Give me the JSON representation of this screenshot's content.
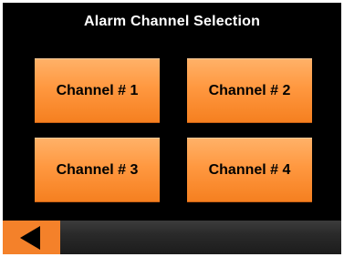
{
  "screen": {
    "title": "Alarm Channel Selection"
  },
  "channels": [
    {
      "label": "Channel # 1"
    },
    {
      "label": "Channel # 2"
    },
    {
      "label": "Channel # 3"
    },
    {
      "label": "Channel # 4"
    }
  ],
  "nav": {
    "back_icon": "left-triangle-icon"
  },
  "colors": {
    "background": "#000000",
    "button": "#ff9840",
    "back_button": "#f4812a",
    "bottom_bar": "#2a2a2a"
  }
}
